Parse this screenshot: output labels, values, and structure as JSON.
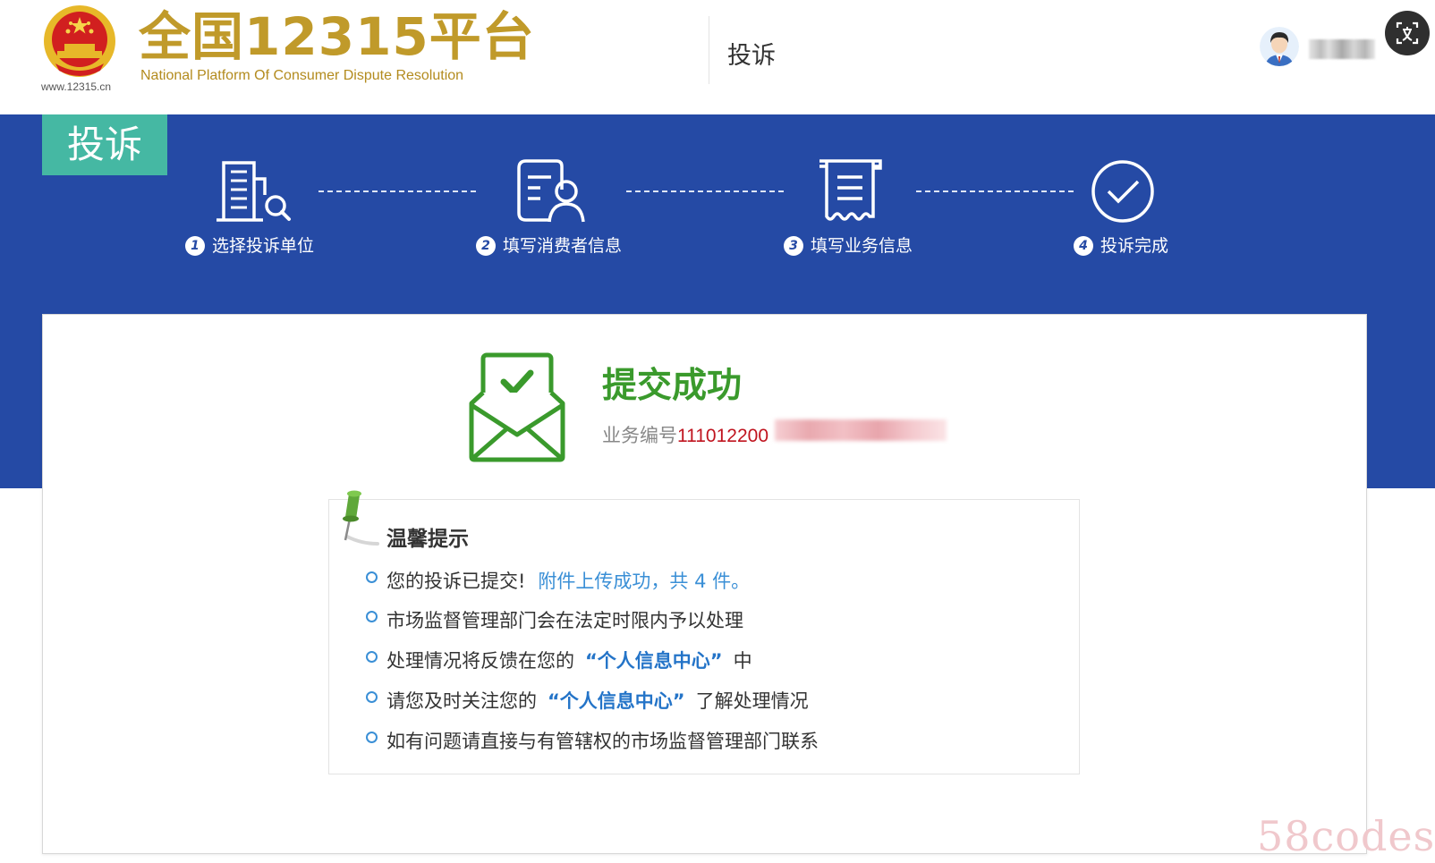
{
  "header": {
    "site_url": "www.12315.cn",
    "brand_title": "全国12315平台",
    "brand_subtitle": "National Platform Of Consumer Dispute Resolution",
    "page_title": "投诉"
  },
  "banner": {
    "tag": "投诉",
    "steps": [
      {
        "num": "1",
        "label": "选择投诉单位"
      },
      {
        "num": "2",
        "label": "填写消费者信息"
      },
      {
        "num": "3",
        "label": "填写业务信息"
      },
      {
        "num": "4",
        "label": "投诉完成"
      }
    ]
  },
  "result": {
    "title": "提交成功",
    "biz_label": "业务编号",
    "biz_number": "111012200"
  },
  "tips": {
    "title": "温馨提示",
    "items": [
      {
        "text": "您的投诉已提交!",
        "link": "附件上传成功，共 4 件。"
      },
      {
        "text": "市场监督管理部门会在法定时限内予以处理"
      },
      {
        "text": "处理情况将反馈在您的",
        "strong": "“个人信息中心”",
        "after": "中"
      },
      {
        "text": "请您及时关注您的",
        "strong": "“个人信息中心”",
        "after": "了解处理情况"
      },
      {
        "text": "如有问题请直接与有管辖权的市场监督管理部门联系"
      }
    ]
  },
  "watermark": "58codes",
  "colors": {
    "banner": "#254aa5",
    "tag": "#45b8a3",
    "success_green": "#3a9a2c",
    "brand_gold": "#c09a2a",
    "biz_number_red": "#c0141f",
    "link_blue": "#3a8fd6"
  }
}
